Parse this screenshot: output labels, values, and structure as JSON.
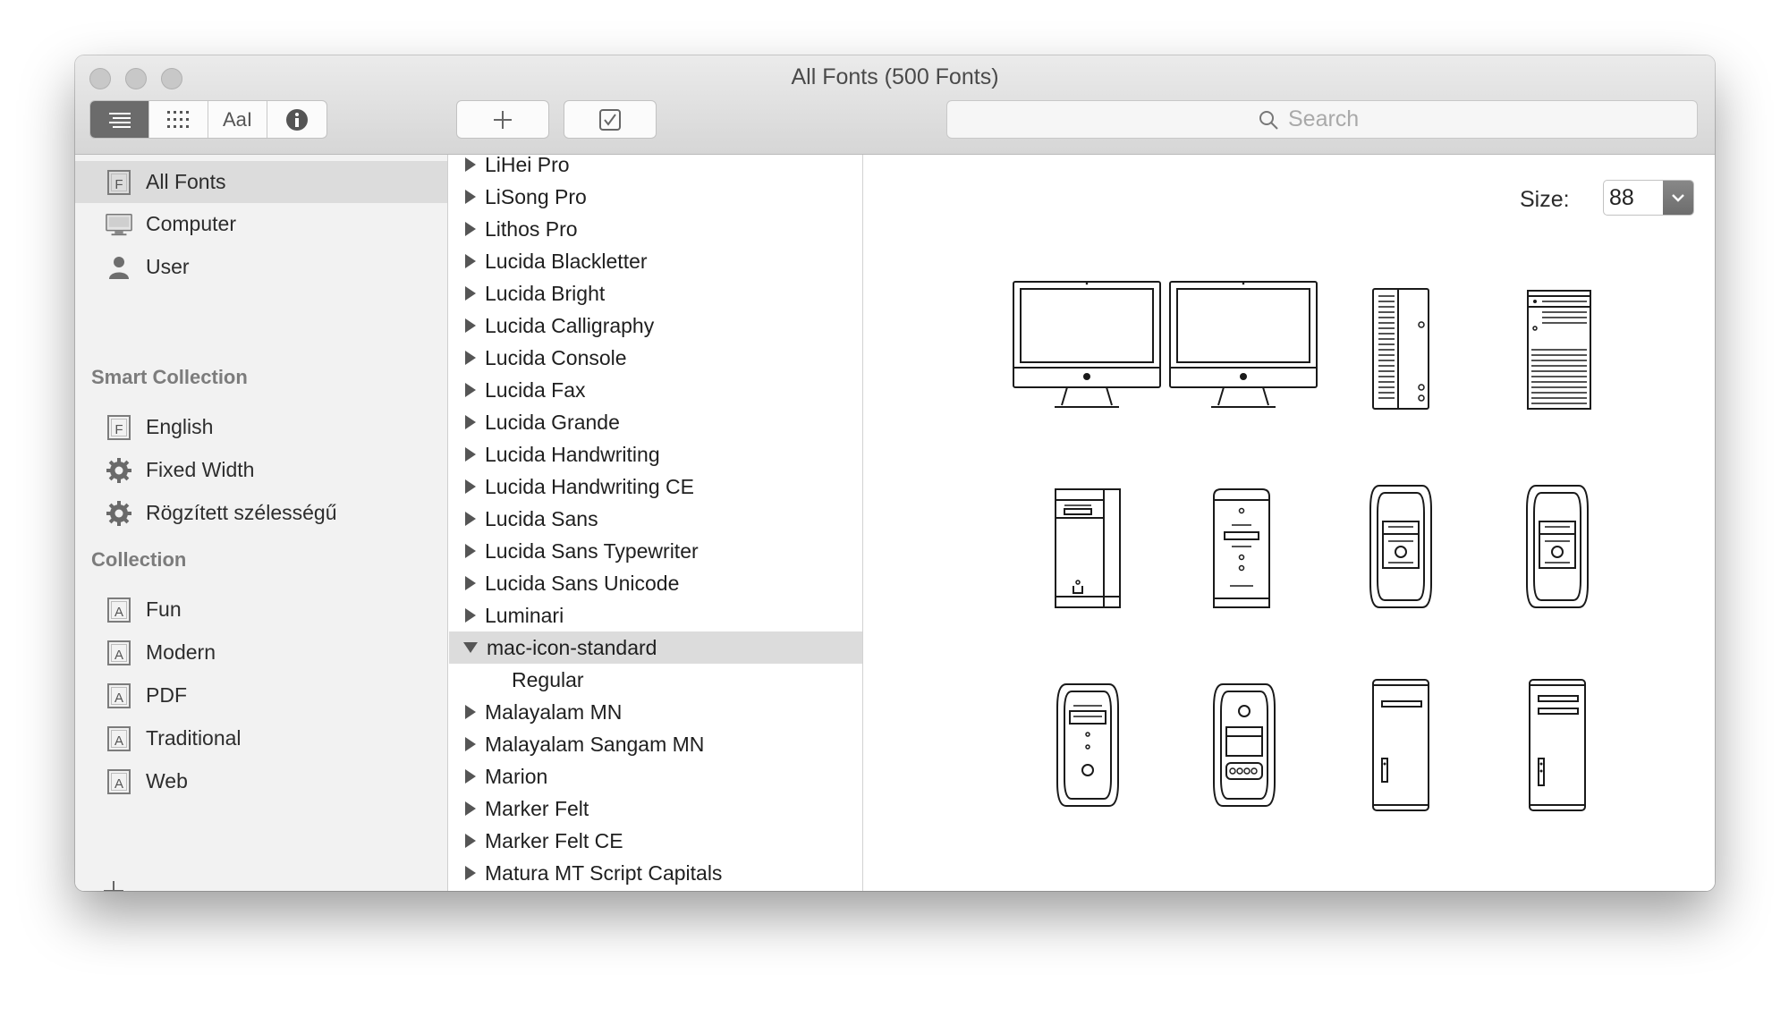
{
  "window": {
    "title": "All Fonts (500 Fonts)"
  },
  "toolbar": {
    "view_buttons": [
      {
        "name": "list-view",
        "icon": "list-icon",
        "active": true
      },
      {
        "name": "grid-view",
        "icon": "grid-icon",
        "active": false
      },
      {
        "name": "sample-view",
        "label": "AaI",
        "icon": "sample-text-icon",
        "active": false
      },
      {
        "name": "info-view",
        "icon": "info-icon",
        "active": false
      }
    ],
    "add_icon": "plus-icon",
    "enable_icon": "checkbox-icon",
    "search": {
      "placeholder": "Search",
      "value": ""
    }
  },
  "sidebar": {
    "library": [
      {
        "label": "All Fonts",
        "icon": "font-file-icon",
        "selected": true
      },
      {
        "label": "Computer",
        "icon": "computer-icon",
        "selected": false
      },
      {
        "label": "User",
        "icon": "user-icon",
        "selected": false
      }
    ],
    "smart_collection_header": "Smart Collection",
    "smart_collections": [
      {
        "label": "English",
        "icon": "font-file-icon"
      },
      {
        "label": "Fixed Width",
        "icon": "gear-icon"
      },
      {
        "label": "Rögzített szélességű",
        "icon": "gear-icon"
      }
    ],
    "collection_header": "Collection",
    "collections": [
      {
        "label": "Fun",
        "icon": "collection-icon"
      },
      {
        "label": "Modern",
        "icon": "collection-icon"
      },
      {
        "label": "PDF",
        "icon": "collection-icon"
      },
      {
        "label": "Traditional",
        "icon": "collection-icon"
      },
      {
        "label": "Web",
        "icon": "collection-icon"
      }
    ],
    "add_icon": "plus-icon"
  },
  "font_list": {
    "items": [
      {
        "label": "LiHei Pro",
        "expanded": false
      },
      {
        "label": "LiSong Pro",
        "expanded": false
      },
      {
        "label": "Lithos Pro",
        "expanded": false
      },
      {
        "label": "Lucida Blackletter",
        "expanded": false
      },
      {
        "label": "Lucida Bright",
        "expanded": false
      },
      {
        "label": "Lucida Calligraphy",
        "expanded": false
      },
      {
        "label": "Lucida Console",
        "expanded": false
      },
      {
        "label": "Lucida Fax",
        "expanded": false
      },
      {
        "label": "Lucida Grande",
        "expanded": false
      },
      {
        "label": "Lucida Handwriting",
        "expanded": false
      },
      {
        "label": "Lucida Handwriting CE",
        "expanded": false
      },
      {
        "label": "Lucida Sans",
        "expanded": false
      },
      {
        "label": "Lucida Sans Typewriter",
        "expanded": false
      },
      {
        "label": "Lucida Sans Unicode",
        "expanded": false
      },
      {
        "label": "Luminari",
        "expanded": false
      },
      {
        "label": "mac-icon-standard",
        "expanded": true,
        "selected": true
      },
      {
        "label": "Regular",
        "sub": true
      },
      {
        "label": "Malayalam MN",
        "expanded": false
      },
      {
        "label": "Malayalam Sangam MN",
        "expanded": false
      },
      {
        "label": "Marion",
        "expanded": false
      },
      {
        "label": "Marker Felt",
        "expanded": false
      },
      {
        "label": "Marker Felt CE",
        "expanded": false
      },
      {
        "label": "Matura MT Script Capitals",
        "expanded": false
      }
    ]
  },
  "preview": {
    "size_label": "Size:",
    "size_value": "88",
    "slider_level": 0.66,
    "glyphs": [
      "imac-icon",
      "imac-icon",
      "xserve-icon",
      "xserve-raid-icon",
      "power-mac-tower-icon",
      "power-mac-cube-icon",
      "power-mac-g4-icon",
      "power-mac-g4-icon",
      "power-mac-g5-icon",
      "power-mac-g5-icon",
      "mac-pro-icon",
      "mac-pro-icon"
    ]
  }
}
